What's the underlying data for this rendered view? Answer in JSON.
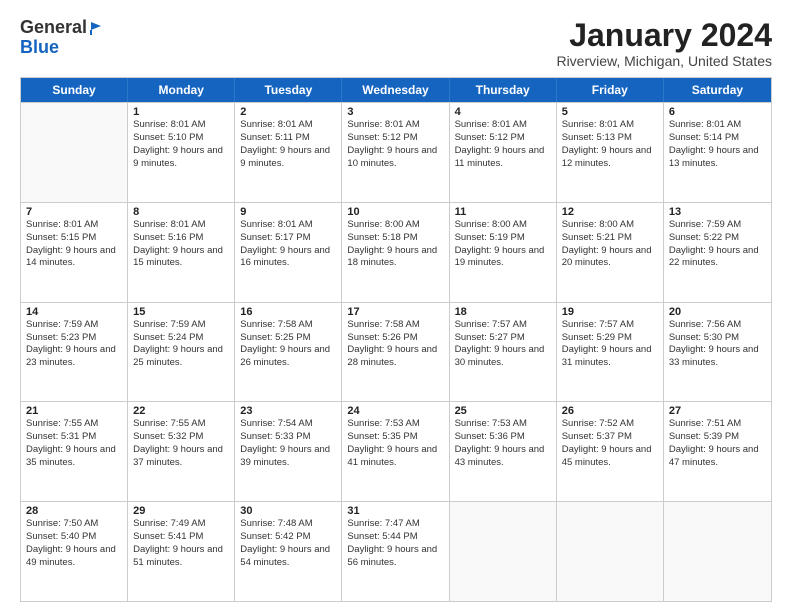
{
  "logo": {
    "general": "General",
    "blue": "Blue"
  },
  "title": "January 2024",
  "subtitle": "Riverview, Michigan, United States",
  "days_of_week": [
    "Sunday",
    "Monday",
    "Tuesday",
    "Wednesday",
    "Thursday",
    "Friday",
    "Saturday"
  ],
  "weeks": [
    [
      {
        "day": "",
        "empty": true
      },
      {
        "day": "1",
        "sunrise": "8:01 AM",
        "sunset": "5:10 PM",
        "daylight": "9 hours and 9 minutes."
      },
      {
        "day": "2",
        "sunrise": "8:01 AM",
        "sunset": "5:11 PM",
        "daylight": "9 hours and 9 minutes."
      },
      {
        "day": "3",
        "sunrise": "8:01 AM",
        "sunset": "5:12 PM",
        "daylight": "9 hours and 10 minutes."
      },
      {
        "day": "4",
        "sunrise": "8:01 AM",
        "sunset": "5:12 PM",
        "daylight": "9 hours and 11 minutes."
      },
      {
        "day": "5",
        "sunrise": "8:01 AM",
        "sunset": "5:13 PM",
        "daylight": "9 hours and 12 minutes."
      },
      {
        "day": "6",
        "sunrise": "8:01 AM",
        "sunset": "5:14 PM",
        "daylight": "9 hours and 13 minutes."
      }
    ],
    [
      {
        "day": "7",
        "sunrise": "8:01 AM",
        "sunset": "5:15 PM",
        "daylight": "9 hours and 14 minutes."
      },
      {
        "day": "8",
        "sunrise": "8:01 AM",
        "sunset": "5:16 PM",
        "daylight": "9 hours and 15 minutes."
      },
      {
        "day": "9",
        "sunrise": "8:01 AM",
        "sunset": "5:17 PM",
        "daylight": "9 hours and 16 minutes."
      },
      {
        "day": "10",
        "sunrise": "8:00 AM",
        "sunset": "5:18 PM",
        "daylight": "9 hours and 18 minutes."
      },
      {
        "day": "11",
        "sunrise": "8:00 AM",
        "sunset": "5:19 PM",
        "daylight": "9 hours and 19 minutes."
      },
      {
        "day": "12",
        "sunrise": "8:00 AM",
        "sunset": "5:21 PM",
        "daylight": "9 hours and 20 minutes."
      },
      {
        "day": "13",
        "sunrise": "7:59 AM",
        "sunset": "5:22 PM",
        "daylight": "9 hours and 22 minutes."
      }
    ],
    [
      {
        "day": "14",
        "sunrise": "7:59 AM",
        "sunset": "5:23 PM",
        "daylight": "9 hours and 23 minutes."
      },
      {
        "day": "15",
        "sunrise": "7:59 AM",
        "sunset": "5:24 PM",
        "daylight": "9 hours and 25 minutes."
      },
      {
        "day": "16",
        "sunrise": "7:58 AM",
        "sunset": "5:25 PM",
        "daylight": "9 hours and 26 minutes."
      },
      {
        "day": "17",
        "sunrise": "7:58 AM",
        "sunset": "5:26 PM",
        "daylight": "9 hours and 28 minutes."
      },
      {
        "day": "18",
        "sunrise": "7:57 AM",
        "sunset": "5:27 PM",
        "daylight": "9 hours and 30 minutes."
      },
      {
        "day": "19",
        "sunrise": "7:57 AM",
        "sunset": "5:29 PM",
        "daylight": "9 hours and 31 minutes."
      },
      {
        "day": "20",
        "sunrise": "7:56 AM",
        "sunset": "5:30 PM",
        "daylight": "9 hours and 33 minutes."
      }
    ],
    [
      {
        "day": "21",
        "sunrise": "7:55 AM",
        "sunset": "5:31 PM",
        "daylight": "9 hours and 35 minutes."
      },
      {
        "day": "22",
        "sunrise": "7:55 AM",
        "sunset": "5:32 PM",
        "daylight": "9 hours and 37 minutes."
      },
      {
        "day": "23",
        "sunrise": "7:54 AM",
        "sunset": "5:33 PM",
        "daylight": "9 hours and 39 minutes."
      },
      {
        "day": "24",
        "sunrise": "7:53 AM",
        "sunset": "5:35 PM",
        "daylight": "9 hours and 41 minutes."
      },
      {
        "day": "25",
        "sunrise": "7:53 AM",
        "sunset": "5:36 PM",
        "daylight": "9 hours and 43 minutes."
      },
      {
        "day": "26",
        "sunrise": "7:52 AM",
        "sunset": "5:37 PM",
        "daylight": "9 hours and 45 minutes."
      },
      {
        "day": "27",
        "sunrise": "7:51 AM",
        "sunset": "5:39 PM",
        "daylight": "9 hours and 47 minutes."
      }
    ],
    [
      {
        "day": "28",
        "sunrise": "7:50 AM",
        "sunset": "5:40 PM",
        "daylight": "9 hours and 49 minutes."
      },
      {
        "day": "29",
        "sunrise": "7:49 AM",
        "sunset": "5:41 PM",
        "daylight": "9 hours and 51 minutes."
      },
      {
        "day": "30",
        "sunrise": "7:48 AM",
        "sunset": "5:42 PM",
        "daylight": "9 hours and 54 minutes."
      },
      {
        "day": "31",
        "sunrise": "7:47 AM",
        "sunset": "5:44 PM",
        "daylight": "9 hours and 56 minutes."
      },
      {
        "day": "",
        "empty": true
      },
      {
        "day": "",
        "empty": true
      },
      {
        "day": "",
        "empty": true
      }
    ]
  ]
}
